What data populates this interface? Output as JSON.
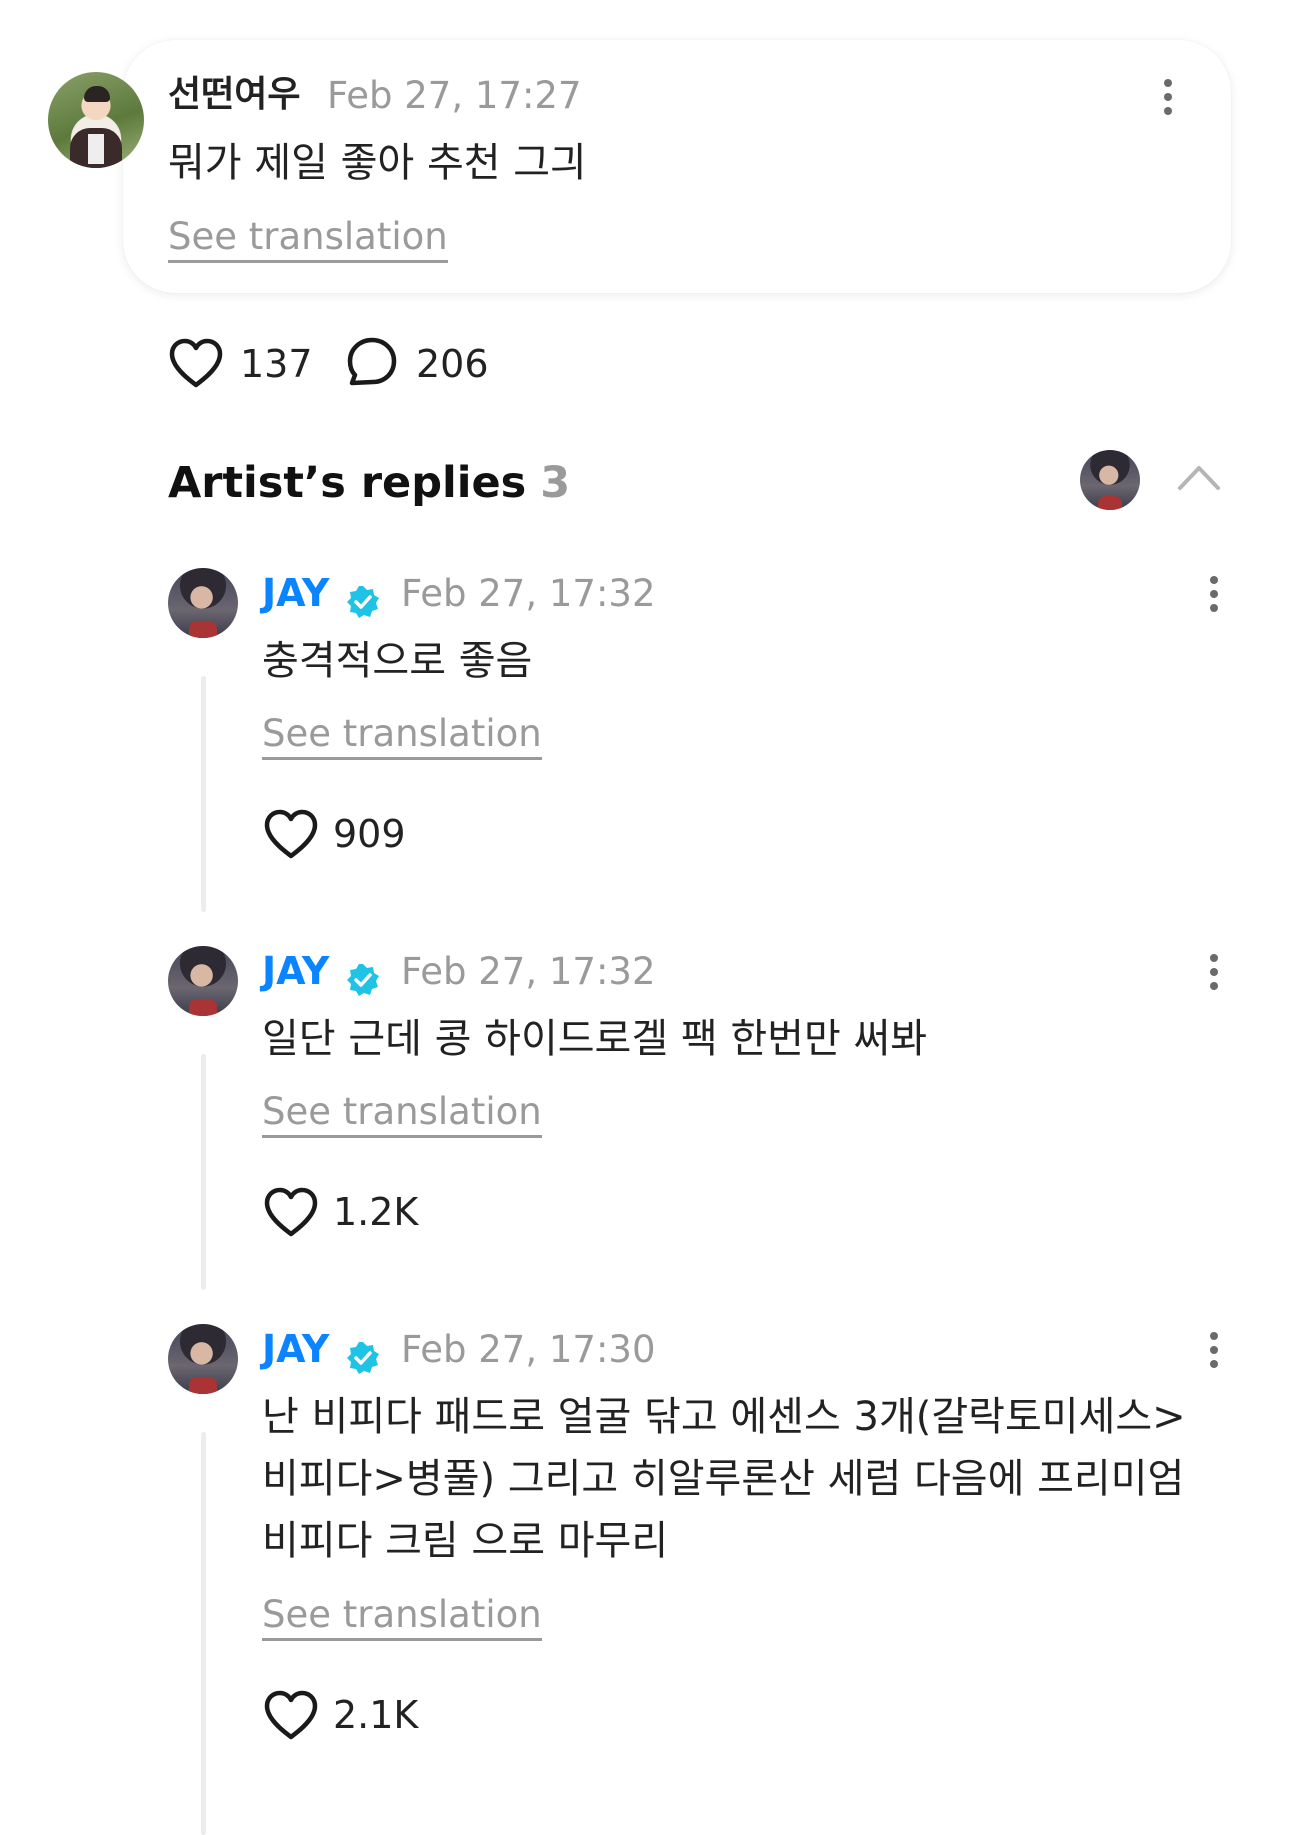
{
  "fan_comment": {
    "author": "선떤여우",
    "timestamp": "Feb 27, 17:27",
    "text": "뭐가 제일 좋아 추천 그긔",
    "translate_label": "See translation",
    "likes": "137",
    "replies": "206"
  },
  "artist_replies": {
    "title": "Artist’s replies",
    "count": "3"
  },
  "replies": [
    {
      "author": "JAY",
      "timestamp": "Feb 27, 17:32",
      "lines": [
        "충격적으로 좋음"
      ],
      "translate_label": "See translation",
      "likes": "909"
    },
    {
      "author": "JAY",
      "timestamp": "Feb 27, 17:32",
      "lines": [
        "일단 근데 콩 하이드로겔 팩 한번만 써봐"
      ],
      "translate_label": "See translation",
      "likes": "1.2K"
    },
    {
      "author": "JAY",
      "timestamp": "Feb 27, 17:30",
      "lines": [
        "난 비피다 패드로 얼굴 닦고 에센스 3개(갈락토미세스>",
        "비피다>병풀) 그리고 히알루론산 세럼 다음에 프리미엄",
        "비피다 크림 으로 마무리"
      ],
      "translate_label": "See translation",
      "likes": "2.1K"
    }
  ],
  "colors": {
    "artist_name": "#0a84ff",
    "verified_badge": "#1ec3e6",
    "muted_text": "#9a9a9a"
  },
  "icons": [
    "kebab-menu-icon",
    "heart-icon",
    "comment-bubble-icon",
    "verified-badge-icon",
    "chevron-up-icon"
  ]
}
